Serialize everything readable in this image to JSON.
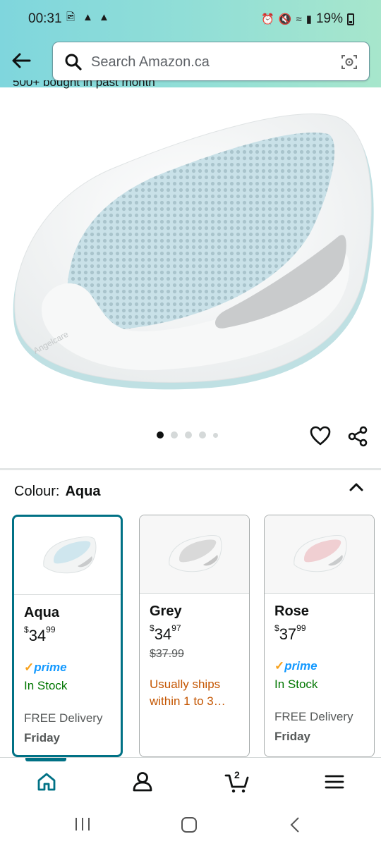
{
  "status_bar": {
    "time": "00:31",
    "battery": "19%"
  },
  "search": {
    "placeholder": "Search Amazon.ca"
  },
  "product": {
    "bought_text": "500+ bought in past month",
    "image_brand": "Angelcare",
    "carousel": {
      "count": 5,
      "active_index": 0
    }
  },
  "colour": {
    "label": "Colour:",
    "selected": "Aqua"
  },
  "options": [
    {
      "name": "Aqua",
      "currency": "$",
      "price_whole": "34",
      "price_cents": "99",
      "was_price": "",
      "prime": "prime",
      "availability": "In Stock",
      "delivery": "FREE Delivery",
      "delivery_day": "Friday",
      "tint": "#cfe6ee",
      "selected": true
    },
    {
      "name": "Grey",
      "currency": "$",
      "price_whole": "34",
      "price_cents": "97",
      "was_price": "$37.99",
      "shipping_note": "Usually ships within 1 to 3…",
      "tint": "#d9d9d9",
      "selected": false
    },
    {
      "name": "Rose",
      "currency": "$",
      "price_whole": "37",
      "price_cents": "99",
      "was_price": "",
      "prime": "prime",
      "availability": "In Stock",
      "delivery": "FREE Delivery",
      "delivery_day": "Friday",
      "tint": "#f0cfd2",
      "selected": false
    }
  ],
  "bottom_nav": {
    "cart_count": "2",
    "active": "home"
  },
  "colors": {
    "accent": "#007185",
    "in_stock": "#007600",
    "ships_note": "#c45500",
    "prime_blue": "#1399ff"
  }
}
